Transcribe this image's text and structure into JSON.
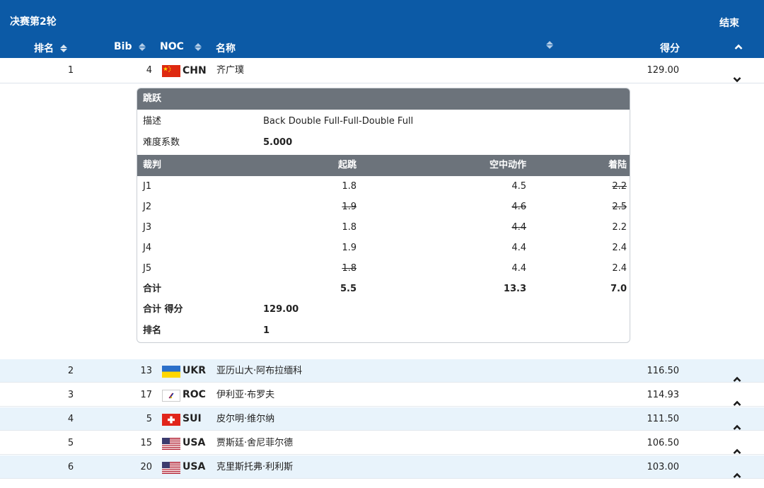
{
  "header": {
    "title": "决赛第2轮",
    "status": "结束",
    "columns": {
      "rank": "排名",
      "bib": "Bib",
      "noc": "NOC",
      "name": "名称",
      "score": "得分"
    }
  },
  "expanded": {
    "rank": "1",
    "bib": "4",
    "noc": "CHN",
    "name": "齐广璞",
    "score": "129.00",
    "detail": {
      "jump_label": "跳跃",
      "desc_label": "描述",
      "desc_value": "Back Double Full-Full-Double Full",
      "dd_label": "难度系数",
      "dd_value": "5.000",
      "judges_header": {
        "judge": "裁判",
        "takeoff": "起跳",
        "air": "空中动作",
        "landing": "着陆"
      },
      "judges": [
        {
          "judge": "J1",
          "takeoff": "1.8",
          "air": "4.5",
          "landing": "2.2"
        },
        {
          "judge": "J2",
          "takeoff": "1.9",
          "air": "4.6",
          "landing": "2.5"
        },
        {
          "judge": "J3",
          "takeoff": "1.8",
          "air": "4.4",
          "landing": "2.2"
        },
        {
          "judge": "J4",
          "takeoff": "1.9",
          "air": "4.4",
          "landing": "2.4"
        },
        {
          "judge": "J5",
          "takeoff": "1.8",
          "air": "4.4",
          "landing": "2.4"
        }
      ],
      "total_label": "合计",
      "total": {
        "takeoff": "5.5",
        "air": "13.3",
        "landing": "7.0"
      },
      "total_score_label": "合计 得分",
      "total_score": "129.00",
      "rank_label": "排名",
      "rank": "1"
    }
  },
  "rows": [
    {
      "rank": "2",
      "bib": "13",
      "noc": "UKR",
      "name": "亚历山大·阿布拉缅科",
      "score": "116.50"
    },
    {
      "rank": "3",
      "bib": "17",
      "noc": "ROC",
      "name": "伊利亚·布罗夫",
      "score": "114.93"
    },
    {
      "rank": "4",
      "bib": "5",
      "noc": "SUI",
      "name": "皮尔明·维尔纳",
      "score": "111.50"
    },
    {
      "rank": "5",
      "bib": "15",
      "noc": "USA",
      "name": "贾斯廷·舍尼菲尔德",
      "score": "106.50"
    },
    {
      "rank": "6",
      "bib": "20",
      "noc": "USA",
      "name": "克里斯托弗·利利斯",
      "score": "103.00"
    }
  ]
}
